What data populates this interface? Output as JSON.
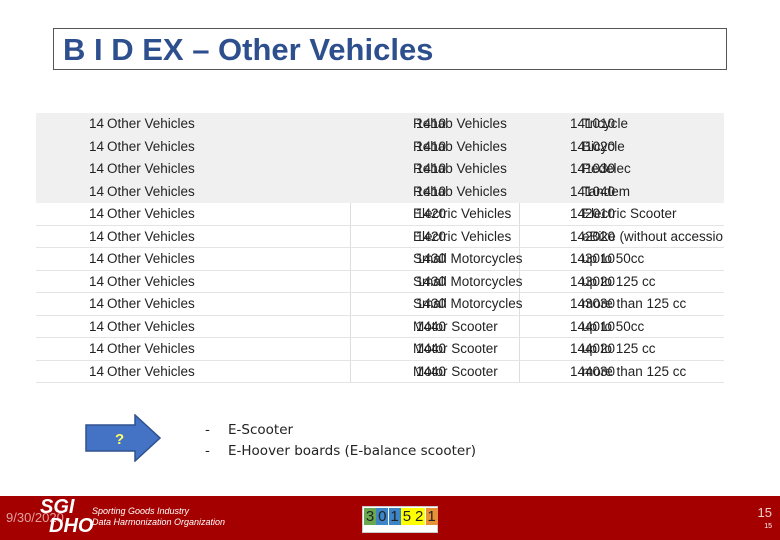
{
  "title": "B I D EX – Other Vehicles",
  "table": {
    "rows": [
      [
        "14",
        "Other Vehicles",
        "1410",
        "Rehab Vehicles",
        "141010",
        "Tricycle"
      ],
      [
        "14",
        "Other Vehicles",
        "1410",
        "Rehab Vehicles",
        "141020",
        "Bicycle"
      ],
      [
        "14",
        "Other Vehicles",
        "1410",
        "Rehab Vehicles",
        "141030",
        "Pedelec"
      ],
      [
        "14",
        "Other Vehicles",
        "1410",
        "Rehab Vehicles",
        "141040",
        "Tandem"
      ],
      [
        "14",
        "Other Vehicles",
        "1420",
        "Electric Vehicles",
        "142010",
        "Electric Scooter"
      ],
      [
        "14",
        "Other Vehicles",
        "1420",
        "Electric Vehicles",
        "142020",
        "eBike (without accessio"
      ],
      [
        "14",
        "Other Vehicles",
        "1430",
        "Small Motorcycles",
        "143010",
        "up to 50cc"
      ],
      [
        "14",
        "Other Vehicles",
        "1430",
        "Small Motorcycles",
        "143020",
        "up to 125 cc"
      ],
      [
        "14",
        "Other Vehicles",
        "1430",
        "Small Motorcycles",
        "143030",
        "more than 125 cc"
      ],
      [
        "14",
        "Other Vehicles",
        "1440",
        "Motor Scooter",
        "144010",
        "up to 50cc"
      ],
      [
        "14",
        "Other Vehicles",
        "1440",
        "Motor Scooter",
        "144020",
        "up to 125 cc"
      ],
      [
        "14",
        "Other Vehicles",
        "1440",
        "Motor Scooter",
        "144030",
        "more than 125 cc"
      ]
    ]
  },
  "arrow": {
    "label": "?",
    "icon": "right-arrow-icon",
    "color": "#4472c4",
    "label_color": "#ffff66"
  },
  "bullets": [
    {
      "dash": "-",
      "text": "E-Scooter"
    },
    {
      "dash": "-",
      "text": "E-Hoover boards (E-balance scooter)"
    }
  ],
  "footer": {
    "date": "9/30/2020",
    "logo_line1": "SGI",
    "logo_line2": "DHO",
    "org_line1": "Sporting Goods Industry",
    "org_line2": "Data Harmonization Organization",
    "digits": [
      "3",
      "0",
      "1",
      "5",
      "2",
      "1"
    ],
    "digit_colors": [
      "#6aa84f",
      "#3d85c6",
      "#3d85c6",
      "#ffff00",
      "#ffff00",
      "#e69138"
    ],
    "page": "15",
    "page_small": "15",
    "bg": "#a50000"
  }
}
